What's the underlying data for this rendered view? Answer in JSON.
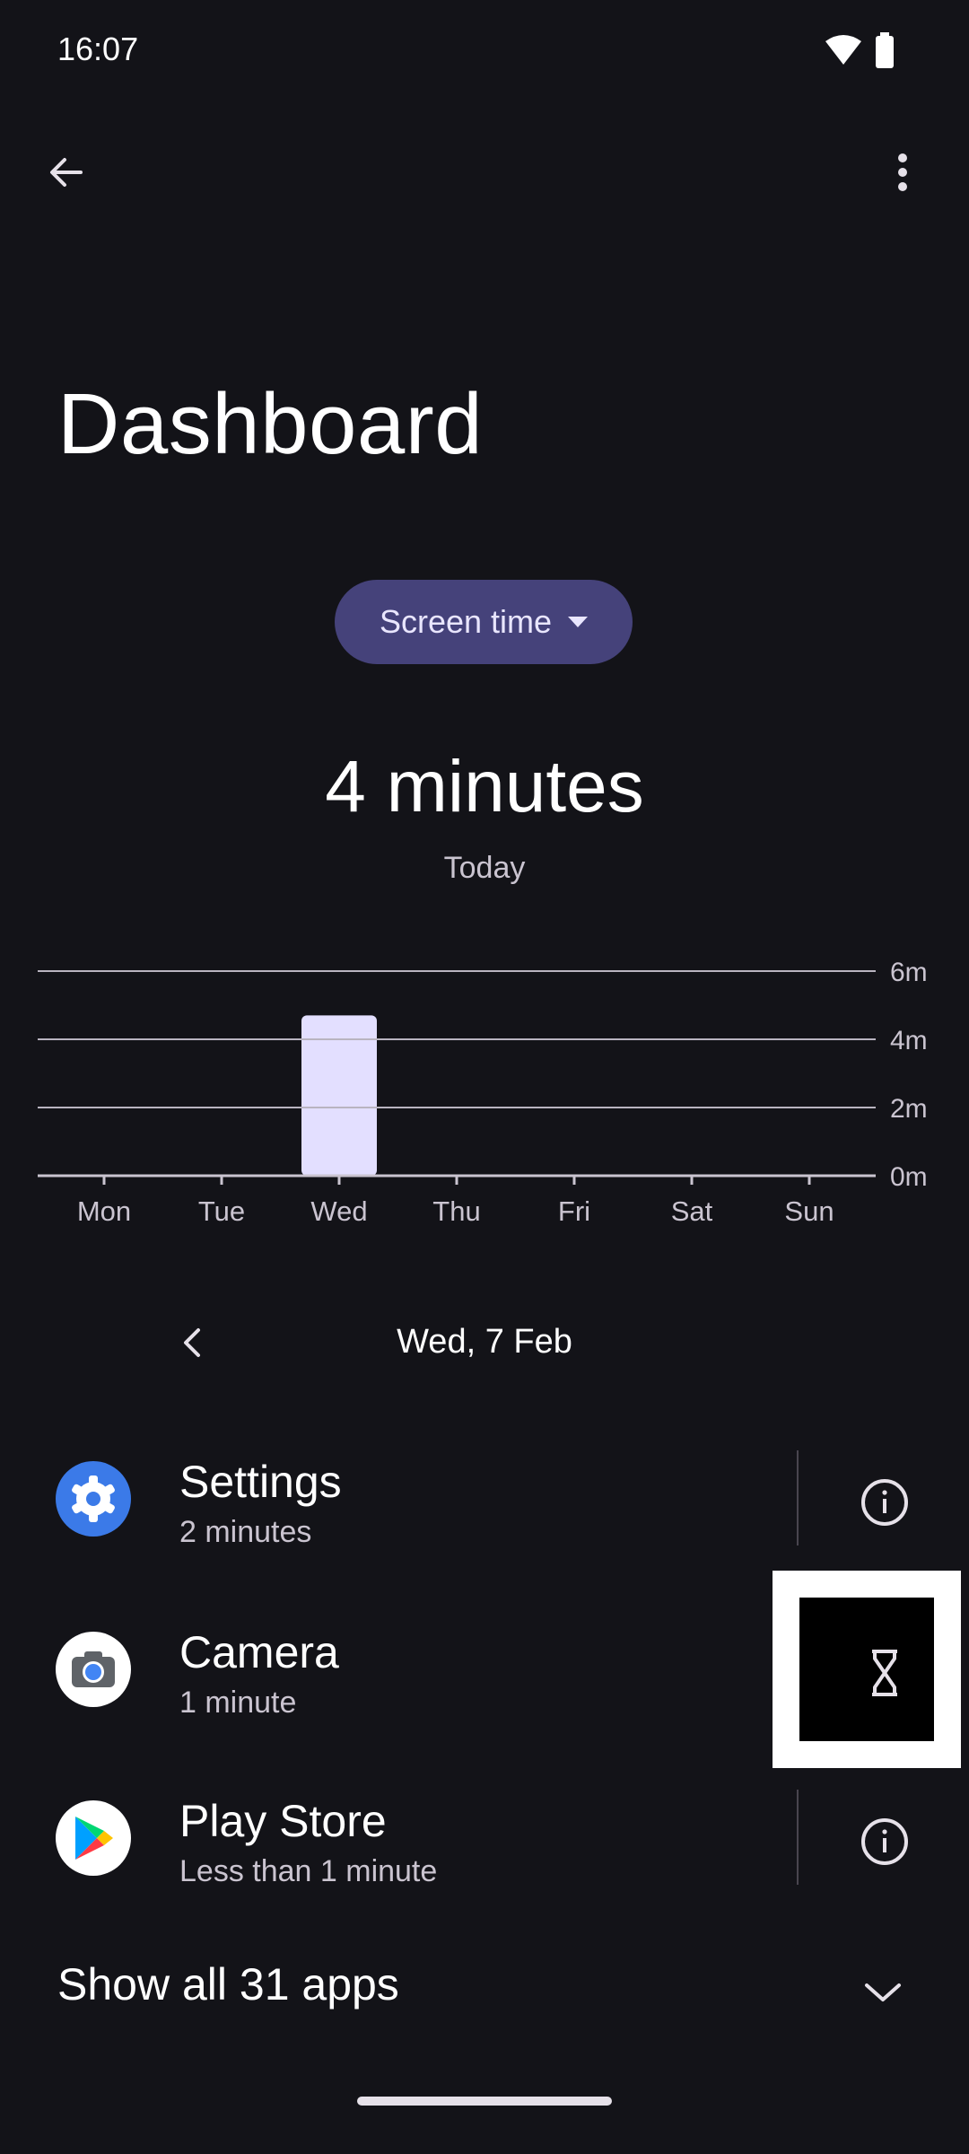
{
  "status_bar": {
    "time": "16:07"
  },
  "header": {
    "title": "Dashboard"
  },
  "metric_selector": {
    "label": "Screen time"
  },
  "summary": {
    "total": "4 minutes",
    "period": "Today"
  },
  "chart_data": {
    "type": "bar",
    "categories": [
      "Mon",
      "Tue",
      "Wed",
      "Thu",
      "Fri",
      "Sat",
      "Sun"
    ],
    "values": [
      0,
      0,
      4.7,
      0,
      0,
      0,
      0
    ],
    "y_ticks": [
      "0m",
      "2m",
      "4m",
      "6m"
    ],
    "ylim": [
      0,
      6
    ],
    "unit": "minutes",
    "grid": true,
    "bar_color": "#e3dfff"
  },
  "date_nav": {
    "current": "Wed, 7 Feb"
  },
  "apps": [
    {
      "name": "Settings",
      "usage": "2 minutes",
      "icon": "gear-icon",
      "action": "info-icon"
    },
    {
      "name": "Camera",
      "usage": "1 minute",
      "icon": "camera-icon",
      "action": "hourglass-icon"
    },
    {
      "name": "Play Store",
      "usage": "Less than 1 minute",
      "icon": "play-store-icon",
      "action": "info-icon"
    }
  ],
  "show_all": {
    "label": "Show all 31 apps"
  },
  "colors": {
    "background": "#131318",
    "chip": "#45427a",
    "bar": "#e3dfff",
    "settings_blue": "#3b7ae8"
  }
}
